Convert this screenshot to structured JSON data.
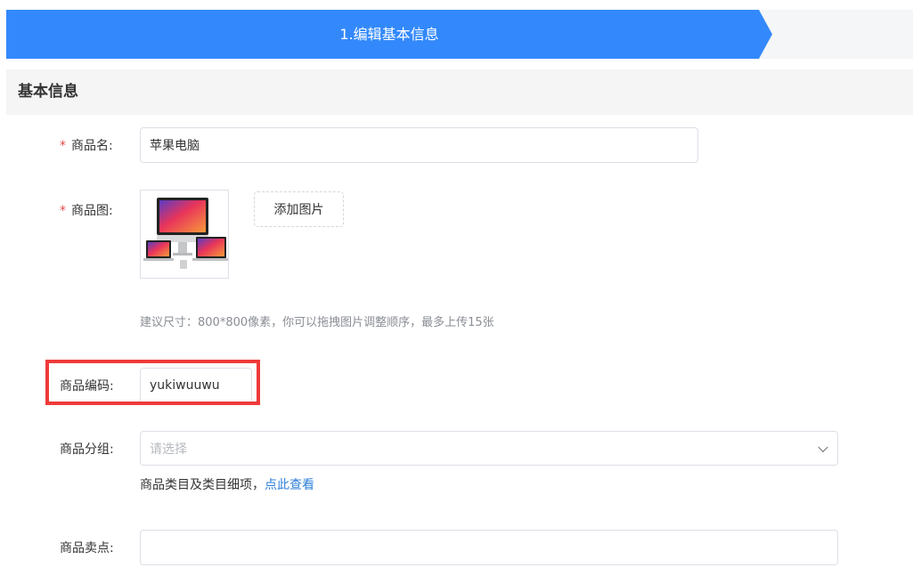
{
  "steps": [
    {
      "label": "1.编辑基本信息",
      "active": true,
      "color": "#3389fb"
    }
  ],
  "section": {
    "title": "基本信息"
  },
  "form": {
    "required_mark": "*",
    "name": {
      "label": "商品名:",
      "value": "苹果电脑"
    },
    "image": {
      "label": "商品图:",
      "add_label": "添加图片",
      "hint": "建议尺寸：800*800像素，你可以拖拽图片调整顺序，最多上传15张"
    },
    "code": {
      "label": "商品编码:",
      "value": "yukiwuuwu",
      "highlight_color": "#ef3a3a"
    },
    "group": {
      "label": "商品分组:",
      "placeholder": "请选择",
      "note_prefix": "商品类目及类目细项，",
      "note_link": "点此查看"
    },
    "selling_point": {
      "label": "商品卖点:",
      "value": ""
    }
  }
}
